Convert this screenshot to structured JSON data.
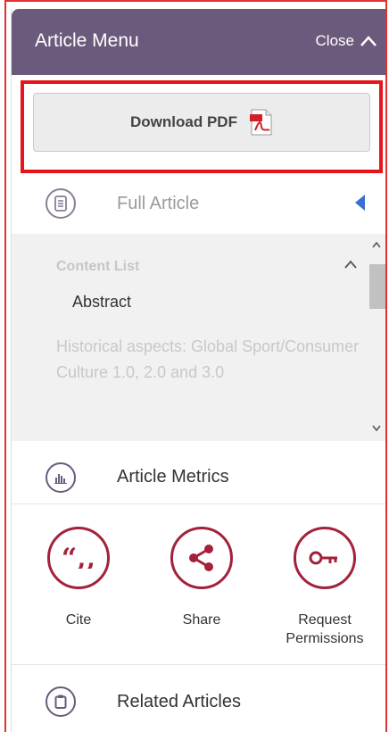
{
  "header": {
    "title": "Article Menu",
    "close_label": "Close",
    "background_color": "#6b5a7c"
  },
  "download": {
    "label": "Download PDF",
    "icon": "pdf-file-icon",
    "highlight_color": "#e8141c"
  },
  "full_article": {
    "label": "Full Article",
    "icon": "document-icon"
  },
  "content_list": {
    "title": "Content List",
    "items": [
      "Abstract",
      "Historical aspects: Global Sport/Consumer Culture 1.0, 2.0 and 3.0"
    ]
  },
  "article_metrics": {
    "label": "Article Metrics",
    "icon": "bar-chart-icon"
  },
  "actions": [
    {
      "label": "Cite",
      "icon": "quote-icon"
    },
    {
      "label": "Share",
      "icon": "share-icon"
    },
    {
      "label": "Request Permissions",
      "icon": "key-icon"
    }
  ],
  "related_articles": {
    "label": "Related Articles",
    "icon": "clipboard-icon"
  },
  "accent_color": "#a3223a"
}
